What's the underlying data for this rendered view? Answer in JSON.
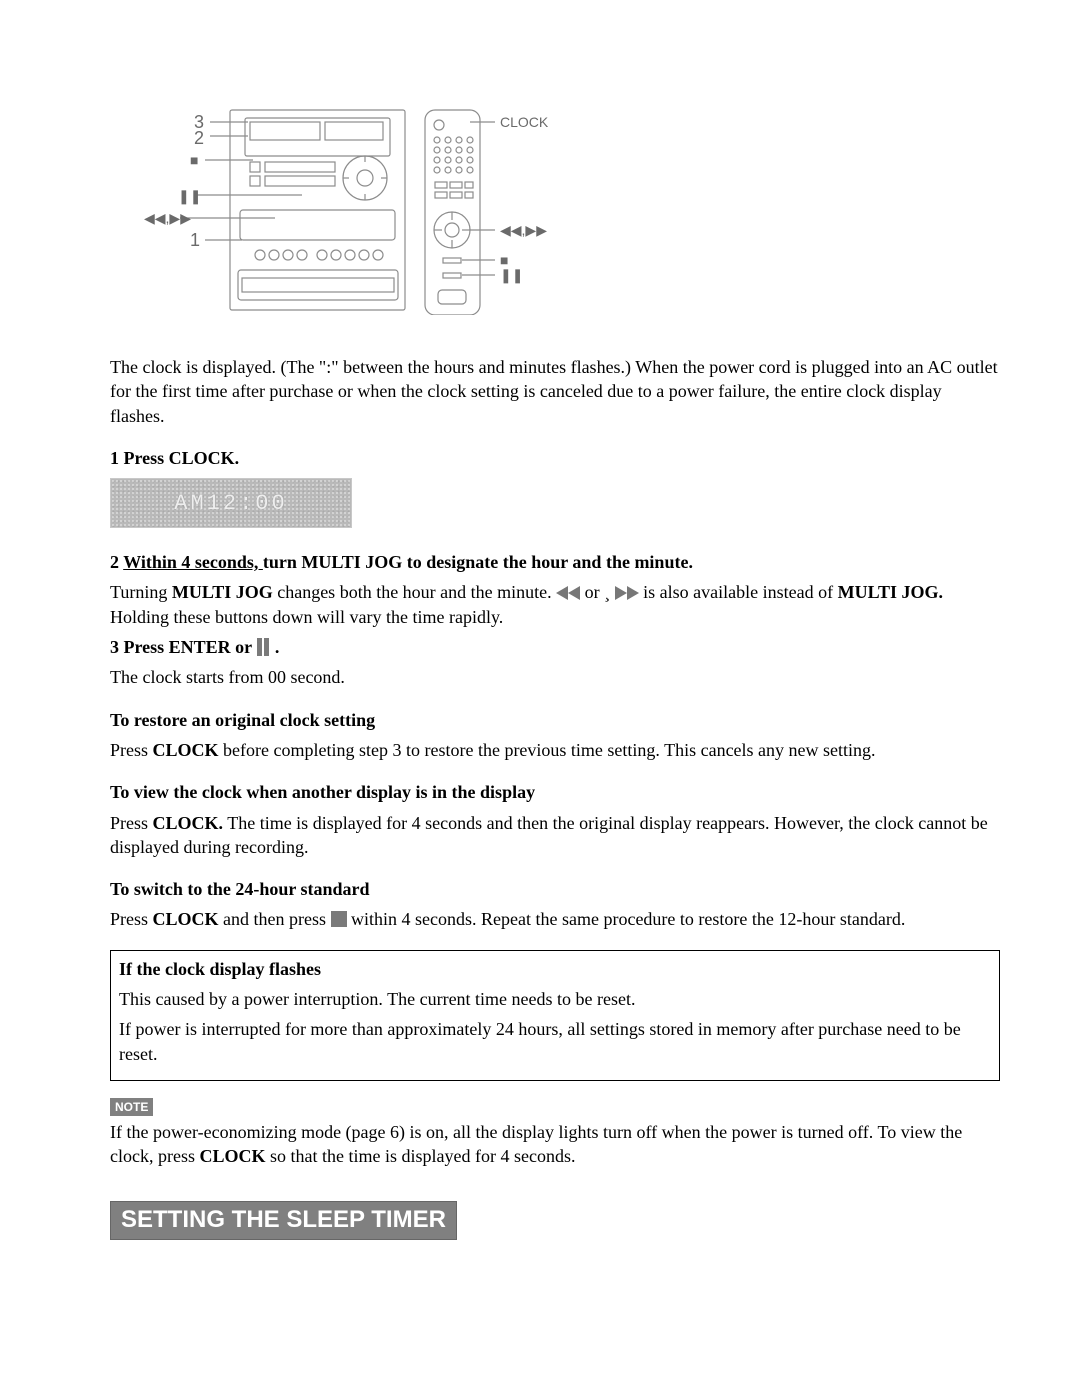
{
  "diagram": {
    "numbers": {
      "n1": "1",
      "n2": "2",
      "n3": "3"
    },
    "labels": {
      "clock": "CLOCK",
      "rewff": "◀◀,▶▶",
      "rewff_remote": "◀◀,▶▶",
      "stop": "■",
      "pause": "❚❚"
    }
  },
  "intro": "The clock is displayed. (The \":\" between the hours and minutes flashes.) When the power cord is plugged into an AC outlet for the first time after purchase or when the clock setting is canceled due to a power failure, the entire clock display flashes.",
  "step1": {
    "num": "1 ",
    "label": "Press CLOCK."
  },
  "lcd_text": "AM12:00",
  "step2": {
    "num": "2 ",
    "underline": "Within 4 seconds, ",
    "rest": "turn MULTI JOG to designate the hour and the minute."
  },
  "step2_body": {
    "a": "Turning ",
    "b": "MULTI JOG",
    "c": " changes both the hour and the minute.   ",
    "d": " or ¸",
    "e": "  is also available instead of ",
    "f": "MULTI JOG.",
    "g": " Holding these buttons down will vary the time rapidly."
  },
  "step3": {
    "num": "3 ",
    "a": "Press ENTER or  ",
    "b": ".",
    "body": "The clock starts from 00 second."
  },
  "restore": {
    "heading": "To restore an original clock setting",
    "a": "Press ",
    "b": "CLOCK",
    "c": " before completing step 3 to restore the previous time setting. This cancels any new setting."
  },
  "view": {
    "heading": "To view the clock when another display is in the display",
    "a": "Press ",
    "b": "CLOCK.",
    "c": " The time is displayed for 4 seconds and then the original display reappears. However, the clock cannot be displayed during recording."
  },
  "switch24": {
    "heading": "To switch to the 24-hour standard",
    "a": "Press ",
    "b": "CLOCK",
    "c": " and then press   ",
    "d": "  within 4 seconds. Repeat the same procedure to restore the 12-hour standard."
  },
  "flashbox": {
    "heading": "If the clock display flashes",
    "line1": "This caused by a power interruption. The current time needs to be reset.",
    "line2": "If power is interrupted for more than approximately 24 hours, all settings stored in memory after purchase need to be reset."
  },
  "note": {
    "badge": "NOTE",
    "a": "If the power-economizing mode (page 6) is on, all the display lights turn off when the power is turned off. To view the clock, press ",
    "b": "CLOCK",
    "c": " so that the time is displayed for 4 seconds."
  },
  "section_heading": "SETTING THE SLEEP TIMER"
}
